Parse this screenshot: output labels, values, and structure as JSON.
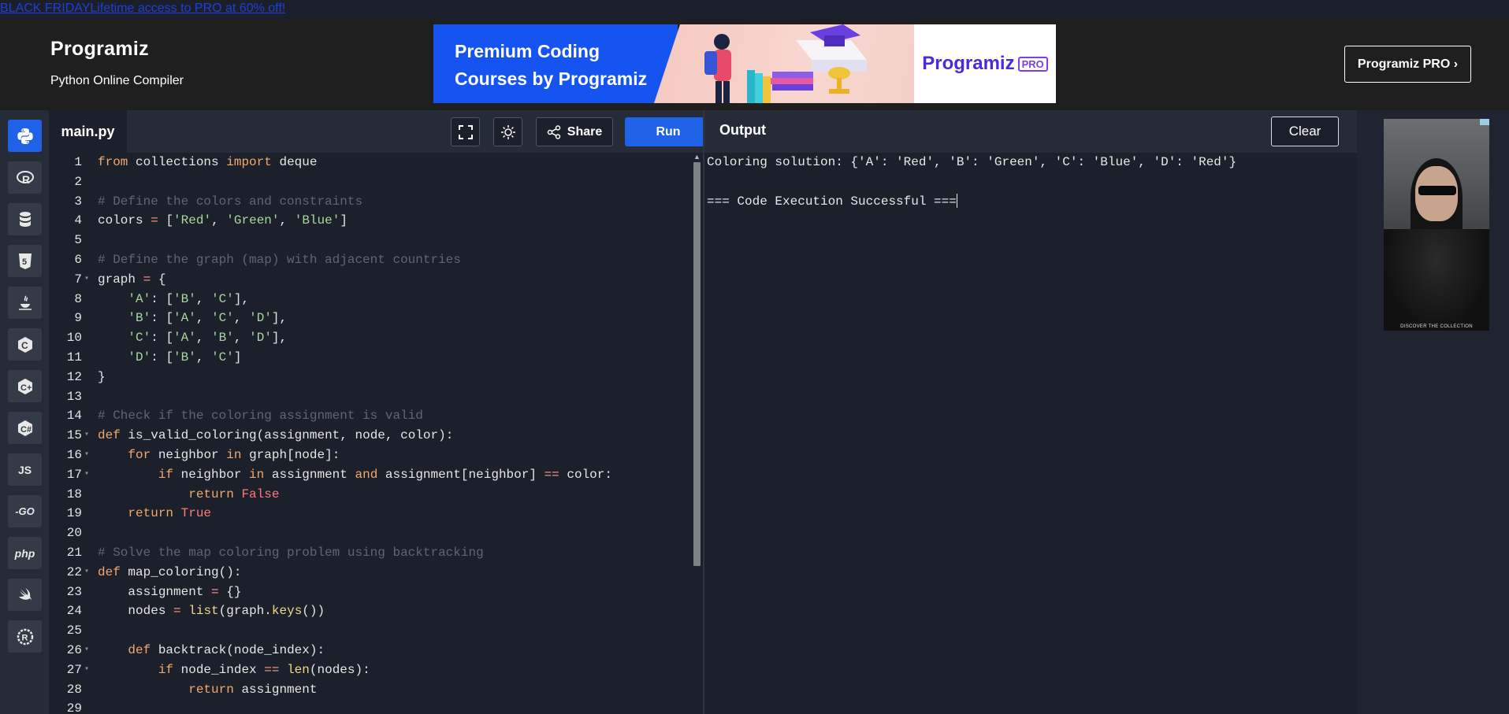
{
  "promo": {
    "highlight": "BLACK FRIDAY",
    "text": "Lifetime access to PRO at 60% off!"
  },
  "header": {
    "logo": "Programiz",
    "subtitle": "Python Online Compiler",
    "banner": {
      "line1": "Premium Coding",
      "line2": "Courses by Programiz",
      "brand": "Programiz",
      "tag": "PRO"
    },
    "pro_button": "Programiz PRO ›"
  },
  "sidebar": {
    "languages": [
      "python-icon",
      "r-icon",
      "sql-icon",
      "html5-icon",
      "java-icon",
      "c-icon",
      "cpp-icon",
      "csharp-icon",
      "js-icon",
      "go-icon",
      "php-icon",
      "swift-icon",
      "rust-icon"
    ],
    "labels": {
      "js": "JS",
      "go": "-GO",
      "php": "php"
    }
  },
  "editor": {
    "filename": "main.py",
    "share": "Share",
    "run": "Run"
  },
  "output": {
    "title": "Output",
    "clear": "Clear",
    "lines": [
      "Coloring solution: {'A': 'Red', 'B': 'Green', 'C': 'Blue', 'D': 'Red'}",
      "",
      "=== Code Execution Successful ==="
    ]
  },
  "ad": {
    "caption": "DISCOVER THE COLLECTION"
  },
  "code": [
    "from collections import deque",
    "",
    "# Define the colors and constraints",
    "colors = ['Red', 'Green', 'Blue']",
    "",
    "# Define the graph (map) with adjacent countries",
    "graph = {",
    "    'A': ['B', 'C'],",
    "    'B': ['A', 'C', 'D'],",
    "    'C': ['A', 'B', 'D'],",
    "    'D': ['B', 'C']",
    "}",
    "",
    "# Check if the coloring assignment is valid",
    "def is_valid_coloring(assignment, node, color):",
    "    for neighbor in graph[node]:",
    "        if neighbor in assignment and assignment[neighbor] == color:",
    "            return False",
    "    return True",
    "",
    "# Solve the map coloring problem using backtracking",
    "def map_coloring():",
    "    assignment = {}",
    "    nodes = list(graph.keys())",
    "",
    "    def backtrack(node_index):",
    "        if node_index == len(nodes):",
    "            return assignment",
    ""
  ],
  "foldable_lines": [
    7,
    15,
    16,
    17,
    22,
    26,
    27
  ]
}
